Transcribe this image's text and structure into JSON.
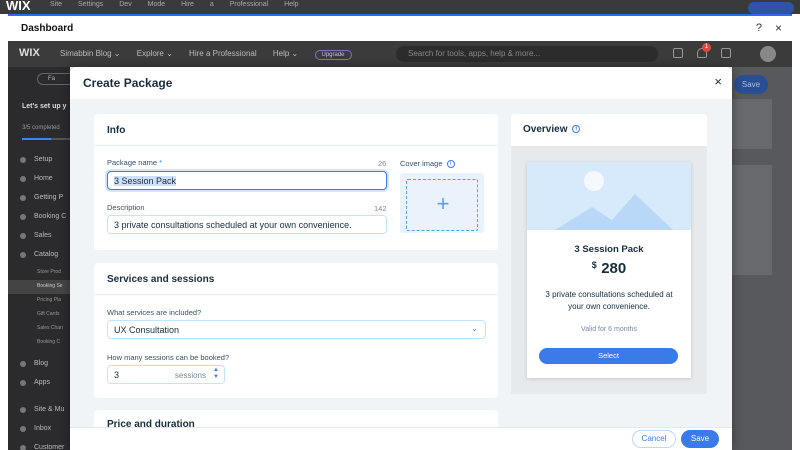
{
  "dashboard": {
    "title": "Dashboard",
    "help_icon": "?",
    "close_icon": "×"
  },
  "topbar": {
    "logo": "WIX",
    "menu": "Site Settings Dev Mode Hire a Professional Help"
  },
  "nav": {
    "logo": "WIX",
    "site_name": "Simabbin Blog ⌄",
    "explore": "Explore ⌄",
    "hire": "Hire a Professional",
    "help": "Help ⌄",
    "upgrade": "Upgrade",
    "search_placeholder": "Search for tools, apps, help & more...",
    "notification_count": "1"
  },
  "sidebar": {
    "favorite": "Fa",
    "setup_title": "Let's set up y",
    "progress_text": "3/5 completed",
    "progress": 0.6,
    "items": [
      {
        "label": "Setup"
      },
      {
        "label": "Home"
      },
      {
        "label": "Getting P"
      },
      {
        "label": "Booking C"
      },
      {
        "label": "Sales"
      },
      {
        "label": "Catalog"
      }
    ],
    "catalog_sub": [
      {
        "label": "Store Prod"
      },
      {
        "label": "Booking Se"
      },
      {
        "label": "Pricing Pla"
      },
      {
        "label": "Gift Cards"
      },
      {
        "label": "Sales Chan"
      },
      {
        "label": "Booking C"
      }
    ],
    "items_bottom": [
      {
        "label": "Blog"
      },
      {
        "label": "Apps"
      },
      {
        "label": "Site & Mu"
      },
      {
        "label": "Inbox"
      },
      {
        "label": "Customer"
      }
    ]
  },
  "background": {
    "save_label": "Save"
  },
  "modal": {
    "title": "Create Package",
    "close_icon": "×",
    "info": {
      "title": "Info",
      "package_name_label": "Package name",
      "required_mark": "*",
      "package_name_count": "26",
      "package_name_value": "3 Session Pack",
      "cover_image_label": "Cover image",
      "description_label": "Description",
      "description_count": "142",
      "description_value": "3 private consultations scheduled at your own convenience."
    },
    "services": {
      "title": "Services and sessions",
      "services_label": "What services are included?",
      "services_value": "UX Consultation",
      "sessions_label": "How many sessions can be booked?",
      "sessions_value": "3",
      "sessions_unit": "sessions"
    },
    "price": {
      "title": "Price and duration"
    },
    "overview": {
      "title": "Overview",
      "package_name": "3 Session Pack",
      "currency": "$",
      "price": "280",
      "description": "3 private consultations scheduled at your own convenience.",
      "validity": "Valid for 6 months",
      "select_label": "Select"
    },
    "footer": {
      "cancel_label": "Cancel",
      "save_label": "Save"
    }
  },
  "colors": {
    "accent": "#3b7be9",
    "text_primary": "#162d3d",
    "body_bg": "#f0f4f7"
  }
}
